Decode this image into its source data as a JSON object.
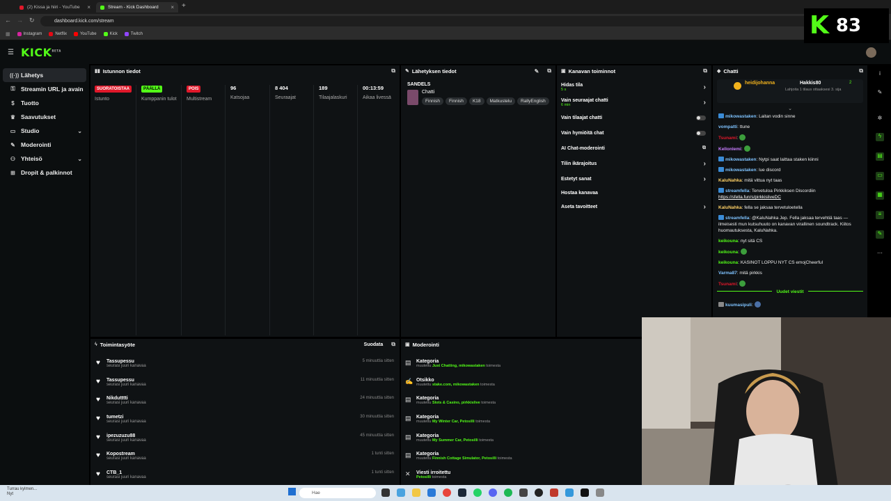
{
  "browser": {
    "tabs": [
      {
        "label": "(2) Kissa ja hiiri - YouTube"
      },
      {
        "label": "Stream - Kick Dashboard"
      }
    ],
    "url": "dashboard.kick.com/stream",
    "bookmarks": [
      "Instagram",
      "Netflix",
      "YouTube",
      "Kick",
      "Twitch"
    ]
  },
  "overlay": {
    "logo": "K",
    "count": "83"
  },
  "kick": {
    "logo": "KICK",
    "beta": "BETA"
  },
  "sidebar": {
    "items": [
      {
        "label": "Lähetys",
        "icon": "broadcast-icon"
      },
      {
        "label": "Streamin URL ja avain",
        "icon": "key-icon"
      },
      {
        "label": "Tuotto",
        "icon": "money-icon"
      },
      {
        "label": "Saavutukset",
        "icon": "trophy-icon"
      },
      {
        "label": "Studio",
        "icon": "studio-icon"
      },
      {
        "label": "Moderointi",
        "icon": "wrench-icon"
      },
      {
        "label": "Yhteisö",
        "icon": "community-icon"
      },
      {
        "label": "Dropit & palkinnot",
        "icon": "gift-icon"
      }
    ]
  },
  "session": {
    "title": "Istunnon tiedot",
    "stats": [
      {
        "badge": "SUORATOISTAA",
        "label": "Istunto"
      },
      {
        "badge": "PÄÄLLÄ",
        "label": "Kumppanin tulot"
      },
      {
        "badge": "POIS",
        "label": "Multistream"
      },
      {
        "value": "96",
        "label": "Katsojaa"
      },
      {
        "value": "8 404",
        "label": "Seuraajat"
      },
      {
        "value": "189",
        "label": "Tilaajalaskuri"
      },
      {
        "value": "00:13:59",
        "label": "Aikaa livessä"
      }
    ],
    "colors": {
      "live": "#e0182a",
      "on": "#53fc18",
      "off": "#e0182a"
    }
  },
  "broadcast": {
    "title": "Lähetyksen tiedot",
    "stream_title": "SANDELS",
    "category": "Chatti",
    "tags": [
      "Finnish",
      "Finnish",
      "K18",
      "Matkustelu",
      "RallyEnglish"
    ]
  },
  "channel_actions": {
    "title": "Kanavan toiminnot",
    "items": [
      {
        "label": "Hidas tila",
        "sub": "5 s",
        "control": "chevron"
      },
      {
        "label": "Vain seuraajat chatti",
        "sub": "6 min",
        "control": "chevron"
      },
      {
        "label": "Vain tilaajat chatti",
        "control": "toggle"
      },
      {
        "label": "Vain hymiöitä chat",
        "control": "toggle"
      },
      {
        "label": "AI Chat-moderointi",
        "control": "open"
      },
      {
        "label": "Tilin ikärajoitus",
        "control": "chevron"
      },
      {
        "label": "Estetyt sanat",
        "control": "chevron"
      },
      {
        "label": "Hostaa kanavaa",
        "control": "none"
      },
      {
        "label": "Aseta tavoitteet",
        "control": "chevron"
      }
    ]
  },
  "chat": {
    "title": "Chatti",
    "pinned": {
      "user1": "heidijohanna",
      "user2": "Hakkis80",
      "count": "2",
      "text": "Lahjoita 1 tilaus ottaaksesi 3. sija"
    },
    "messages": [
      {
        "user": "mikowastaken",
        "color": "#7fc3ff",
        "text": "Laitan vodin sinne",
        "mod": true
      },
      {
        "user": "vompatti",
        "color": "#7fc3ff",
        "text": "ttune"
      },
      {
        "user": "Tsunami",
        "color": "#e0182a",
        "text": "",
        "emote": true
      },
      {
        "user": "Kellonlemi",
        "color": "#c77dff",
        "text": "",
        "emote": true
      },
      {
        "user": "mikowastaken",
        "color": "#7fc3ff",
        "text": "Nytpi saat laittaa staken kiinni",
        "mod": true
      },
      {
        "user": "mikowastaken",
        "color": "#7fc3ff",
        "text": "lue discord",
        "mod": true
      },
      {
        "user": "KaluNahka",
        "color": "#ffd166",
        "text": "mitä vittua nyt taas"
      },
      {
        "user": "streamfella",
        "color": "#7fc3ff",
        "text": "Tervetuloa Pirkkiksen Discordiin",
        "mod": true,
        "link": "https://sfella.fun/s/pirkkislivеDC"
      },
      {
        "user": "KaluNahka",
        "color": "#ffd166",
        "text": "fella se jaksaa tervetuloetella"
      },
      {
        "user": "streamfella",
        "color": "#7fc3ff",
        "text": "@KaluNahka Jep. Fella jaksaa tervehtiä taas — ilmeisesti mun kutsuhuuto on kanavan virallinen soundtrack. Kiitos huomautuksesta, KaluNahka.",
        "mod": true
      },
      {
        "user": "keikouna",
        "color": "#53fc18",
        "text": "nyt sitä CS"
      },
      {
        "user": "keikouna",
        "color": "#53fc18",
        "text": "",
        "emote": true
      },
      {
        "user": "keikouna",
        "color": "#53fc18",
        "text": "KASINOT LOPPU NYT CS emojCheerful"
      },
      {
        "user": "Varma87",
        "color": "#7fc3ff",
        "text": "mitä pirkkis"
      },
      {
        "user": "Tsunami",
        "color": "#e0182a",
        "text": "",
        "emote": true
      }
    ],
    "new_messages": "Uudet viestit",
    "after": [
      {
        "user": "kuumasipuli",
        "color": "#7fc3ff",
        "text": ""
      }
    ]
  },
  "activity": {
    "title": "Toimintasyöte",
    "filter": "Suodata",
    "items": [
      {
        "name": "Tassupessu",
        "sub": "seurasi juuri kanavaa",
        "time": "5 minuuttia sitten"
      },
      {
        "name": "Tassupessu",
        "sub": "seurasi juuri kanavaa",
        "time": "11 minuuttia sitten"
      },
      {
        "name": "Nikdutttti",
        "sub": "seurasi juuri kanavaa",
        "time": "24 minuuttia sitten"
      },
      {
        "name": "tumetzi",
        "sub": "seurasi juuri kanavaa",
        "time": "30 minuuttia sitten"
      },
      {
        "name": "ipezuzuzu88",
        "sub": "seurasi juuri kanavaa",
        "time": "45 minuuttia sitten"
      },
      {
        "name": "Kopostream",
        "sub": "seurasi juuri kanavaa",
        "time": "1 tunti sitten"
      },
      {
        "name": "CTB_1",
        "sub": "seurasi juuri kanavaa",
        "time": "1 tunti sitten"
      }
    ]
  },
  "moderation": {
    "title": "Moderointi",
    "items": [
      {
        "title": "Kategoria",
        "prefix": "muutettu",
        "value": "Just Chatting,",
        "by": "mikowastaken",
        "suffix": "toimesta",
        "icon": "category-icon"
      },
      {
        "title": "Otsikko",
        "prefix": "muutettu",
        "value": "stake.com,",
        "by": "mikowastaken",
        "suffix": "toimesta",
        "icon": "title-icon"
      },
      {
        "title": "Kategoria",
        "prefix": "muutettu",
        "value": "Slots & Casino,",
        "by": "pirkkislive",
        "suffix": "toimesta",
        "icon": "category-icon"
      },
      {
        "title": "Kategoria",
        "prefix": "muutettu",
        "value": "My Winter Car,",
        "by": "Petosilli",
        "suffix": "toimesta",
        "icon": "category-icon"
      },
      {
        "title": "Kategoria",
        "prefix": "muutettu",
        "value": "My Summer Car,",
        "by": "Petosilli",
        "suffix": "toimesta",
        "icon": "category-icon"
      },
      {
        "title": "Kategoria",
        "prefix": "muutettu",
        "value": "Finnish Cottage Simulator,",
        "by": "Petosilli",
        "suffix": "toimesta",
        "icon": "category-icon"
      },
      {
        "title": "Viesti irroitettu",
        "prefix": "",
        "value": "",
        "by": "Petosilli",
        "suffix": "toimesta",
        "icon": "unpin-icon"
      }
    ]
  },
  "taskbar": {
    "search_placeholder": "Hae",
    "weather": "Turrau kylmen...",
    "weather_sub": "Nyt"
  }
}
